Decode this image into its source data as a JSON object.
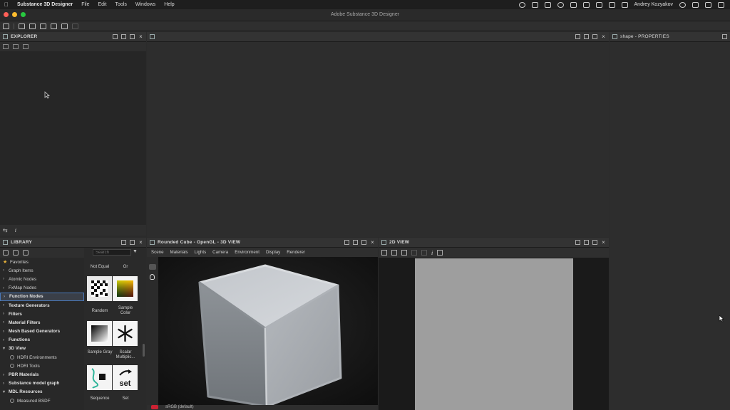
{
  "menubar": {
    "app_name": "Substance 3D Designer",
    "menus": [
      "File",
      "Edit",
      "Tools",
      "Windows",
      "Help"
    ],
    "user": "Andrey Kozyakov"
  },
  "window": {
    "title": "Adobe Substance 3D Designer"
  },
  "explorer": {
    "title": "EXPLORER"
  },
  "properties": {
    "title": "shape - PROPERTIES"
  },
  "library": {
    "title": "LIBRARY",
    "search_placeholder": "Search",
    "tree": [
      {
        "label": "Favorites",
        "kind": "favorite"
      },
      {
        "label": "Graph Items",
        "kind": "collapsed"
      },
      {
        "label": "Atomic Nodes",
        "kind": "collapsed"
      },
      {
        "label": "FxMap Nodes",
        "kind": "collapsed"
      },
      {
        "label": "Function Nodes",
        "kind": "selected"
      },
      {
        "label": "Texture Generators",
        "kind": "bold"
      },
      {
        "label": "Filters",
        "kind": "bold"
      },
      {
        "label": "Material Filters",
        "kind": "bold"
      },
      {
        "label": "Mesh Based Generators",
        "kind": "bold"
      },
      {
        "label": "Functions",
        "kind": "bold"
      },
      {
        "label": "3D View",
        "kind": "open"
      },
      {
        "label": "HDRI Environments",
        "kind": "sub"
      },
      {
        "label": "HDRI Tools",
        "kind": "sub"
      },
      {
        "label": "PBR Materials",
        "kind": "bold"
      },
      {
        "label": "Substance model graph",
        "kind": "bold"
      },
      {
        "label": "MDL Resources",
        "kind": "open"
      },
      {
        "label": "Measured BSDF",
        "kind": "sub"
      }
    ],
    "nodes": {
      "row0": [
        "Not Equal",
        "Or"
      ],
      "row1": [
        "Random",
        "Sample Color"
      ],
      "row2": [
        "Sample Gray",
        "Scalar Multiplic..."
      ],
      "row3": [
        "Sequence",
        "Set"
      ]
    },
    "set_glyph": "set"
  },
  "view3d": {
    "title": "Rounded Cube - OpenGL - 3D VIEW",
    "menu": [
      "Scene",
      "Materials",
      "Lights",
      "Camera",
      "Environment",
      "Display",
      "Renderer"
    ],
    "colorspace": "sRGB (default)"
  },
  "view2d": {
    "title": "2D VIEW"
  },
  "colors": {
    "accent": "#4a78b8",
    "star": "#e8b23a",
    "canvas": "#9e9e9e"
  }
}
